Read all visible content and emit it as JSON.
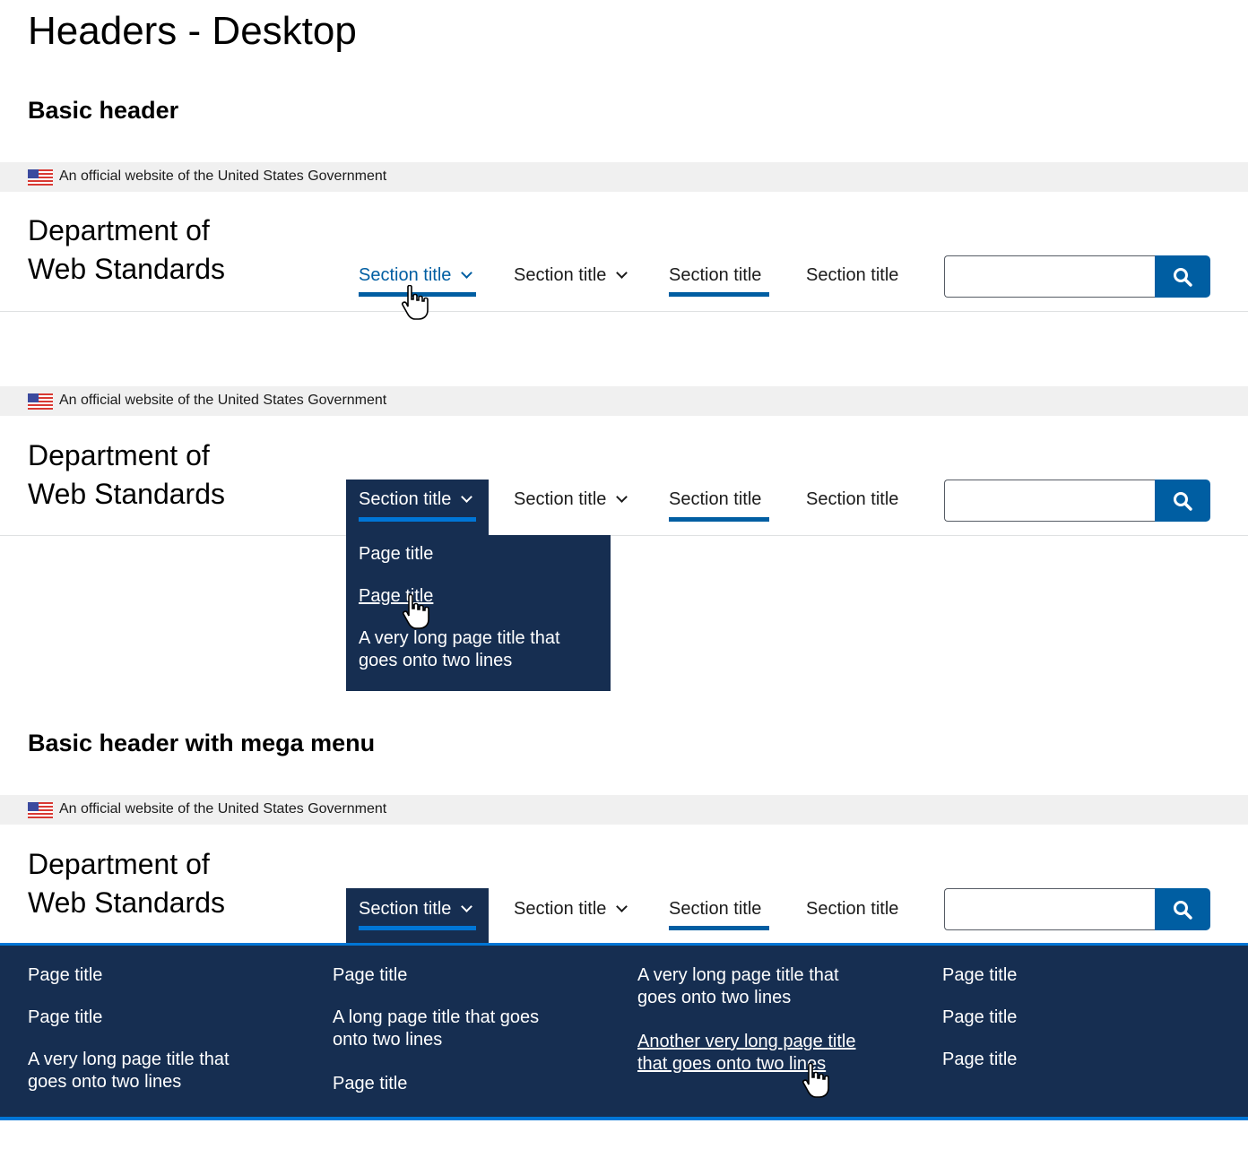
{
  "page": {
    "title": "Headers - Desktop"
  },
  "sections": {
    "basic": "Basic header",
    "mega": "Basic header with mega menu"
  },
  "banner": {
    "text": "An official website of the United States Government",
    "flag_icon": "us-flag-icon"
  },
  "site": {
    "line1": "Department of",
    "line2": "Web Standards"
  },
  "nav": {
    "item1": "Section title",
    "item2": "Section title",
    "item3": "Section title",
    "item4": "Section title"
  },
  "search": {
    "icon": "search-icon",
    "value": ""
  },
  "dropdown": {
    "items": [
      "Page title",
      "Page title",
      "A very long page title that",
      "goes onto two lines"
    ]
  },
  "mega_menu": {
    "col1": [
      "Page title",
      "Page title",
      "A very long page title that",
      "goes onto two lines"
    ],
    "col2": [
      "Page title",
      "A long page title that goes",
      "onto two lines",
      "Page title"
    ],
    "col3": [
      "A very long page title that",
      "goes onto two lines",
      "Another very long page title",
      "that goes onto two lines"
    ],
    "col4": [
      "Page title",
      "Page title",
      "Page title"
    ]
  },
  "colors": {
    "primary": "#005ea2",
    "primary_dark": "#162e51",
    "accent": "#0076d6",
    "banner_bg": "#f0f0f0"
  }
}
